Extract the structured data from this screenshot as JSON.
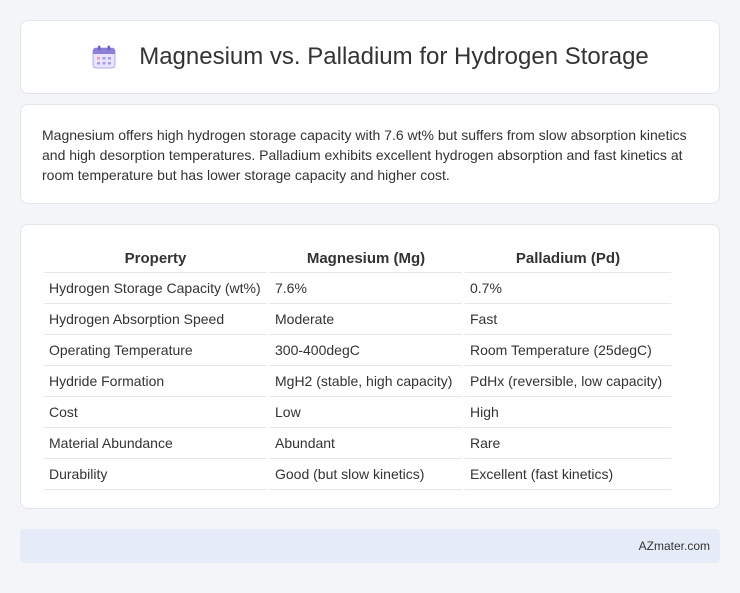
{
  "header": {
    "title": "Magnesium vs. Palladium for Hydrogen Storage",
    "icon": "calendar-icon"
  },
  "summary": {
    "text": "Magnesium offers high hydrogen storage capacity with 7.6 wt% but suffers from slow absorption kinetics and high desorption temperatures. Palladium exhibits excellent hydrogen absorption and fast kinetics at room temperature but has lower storage capacity and higher cost."
  },
  "table": {
    "headers": [
      "Property",
      "Magnesium (Mg)",
      "Palladium (Pd)"
    ],
    "rows": [
      [
        "Hydrogen Storage Capacity (wt%)",
        "7.6%",
        "0.7%"
      ],
      [
        "Hydrogen Absorption Speed",
        "Moderate",
        "Fast"
      ],
      [
        "Operating Temperature",
        "300-400degC",
        "Room Temperature (25degC)"
      ],
      [
        "Hydride Formation",
        "MgH2 (stable, high capacity)",
        "PdHx (reversible, low capacity)"
      ],
      [
        "Cost",
        "Low",
        "High"
      ],
      [
        "Material Abundance",
        "Abundant",
        "Rare"
      ],
      [
        "Durability",
        "Good (but slow kinetics)",
        "Excellent (fast kinetics)"
      ]
    ]
  },
  "footer": {
    "text": "AZmater.com"
  },
  "colors": {
    "background": "#f3f5f9",
    "card": "#ffffff",
    "footer": "#e6ecf7",
    "icon_accent": "#8b7fd6"
  }
}
